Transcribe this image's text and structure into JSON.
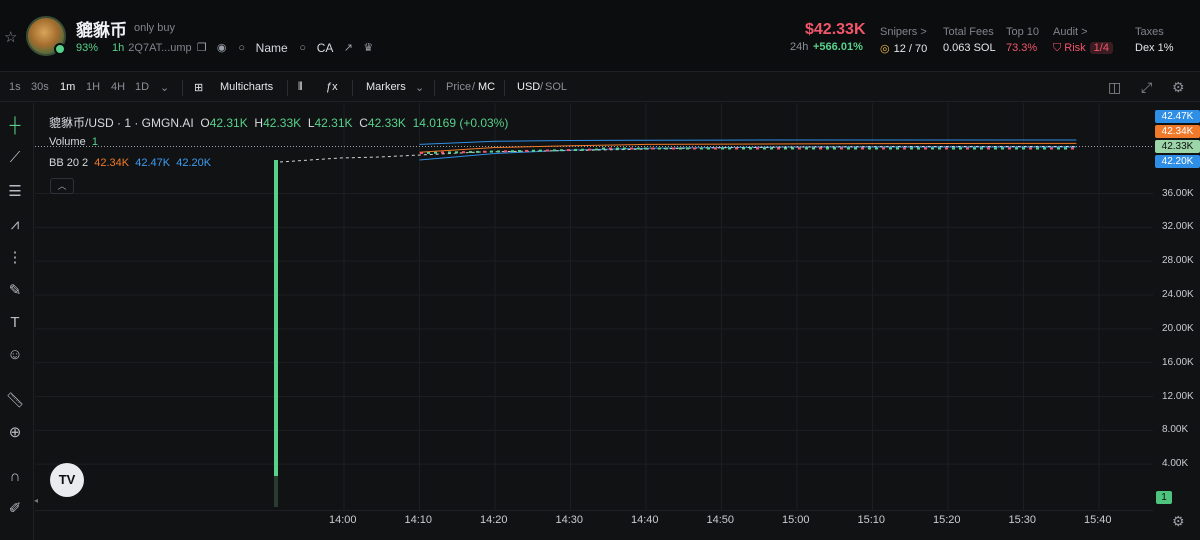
{
  "header": {
    "token_name": "貔貅币",
    "tag": "only buy",
    "holder_pct": "93%",
    "age": "1h",
    "address": "2Q7AT...ump",
    "links": [
      "Name",
      "CA"
    ],
    "price": "$42.33K",
    "change_label": "24h",
    "change_value": "+566.01%",
    "stats": [
      {
        "label": "Snipers >",
        "value": "12 / 70"
      },
      {
        "label": "Total Fees",
        "value": "0.063 SOL"
      },
      {
        "label": "Top 10",
        "value": "73.3%"
      },
      {
        "label": "Audit >",
        "value": "Risk",
        "badge": "1/4"
      },
      {
        "label": "Taxes",
        "value": "Dex 1%"
      }
    ]
  },
  "toolbar": {
    "intervals": [
      "1s",
      "30s",
      "1m",
      "1H",
      "4H",
      "1D"
    ],
    "active_interval": "1m",
    "multicharts": "Multicharts",
    "markers": "Markers",
    "price_mc": [
      "Price",
      "MC"
    ],
    "usd_sol": [
      "USD",
      "SOL"
    ]
  },
  "legend": {
    "symbol": "貔貅币/USD · 1 · GMGN.AI",
    "o_label": "O",
    "o": "42.31K",
    "h_label": "H",
    "h": "42.33K",
    "l_label": "L",
    "l": "42.31K",
    "c_label": "C",
    "c": "42.33K",
    "change": "14.0169 (+0.03%)",
    "volume_label": "Volume",
    "volume": "1",
    "bb_label": "BB 20 2",
    "bb_basis": "42.34K",
    "bb_upper": "42.47K",
    "bb_lower": "42.20K"
  },
  "tv_logo": "TV",
  "colors": {
    "up": "#58d18a",
    "down": "#f2566b",
    "bb_upper": "#2f8fe6",
    "bb_basis": "#f07a2a",
    "price_tag": "#9cd6a8"
  },
  "chart_data": {
    "type": "line",
    "title": "貔貅币/USD · 1 · GMGN.AI",
    "ylim": [
      0,
      42470
    ],
    "y_ticks": [
      "36.00K",
      "32.00K",
      "28.00K",
      "24.00K",
      "20.00K",
      "16.00K",
      "12.00K",
      "8.00K",
      "4.00K"
    ],
    "x_ticks": [
      "14:00",
      "14:10",
      "14:20",
      "14:30",
      "14:40",
      "14:50",
      "15:00",
      "15:10",
      "15:20",
      "15:30",
      "15:40"
    ],
    "price_tags": [
      {
        "value": "42.47K",
        "color": "#2f8fe6"
      },
      {
        "value": "42.34K",
        "color": "#f07a2a"
      },
      {
        "value": "42.33K",
        "color": "#9cd6a8"
      },
      {
        "value": "42.20K",
        "color": "#2f8fe6"
      }
    ],
    "volume_tag": "1",
    "series": [
      {
        "name": "BB basis",
        "x": [
          "14:10",
          "14:20",
          "14:30",
          "14:40",
          "14:50",
          "15:00",
          "15:10",
          "15:20",
          "15:30",
          "15:37"
        ],
        "values": [
          42000,
          42180,
          42250,
          42300,
          42310,
          42320,
          42330,
          42335,
          42340,
          42340
        ]
      },
      {
        "name": "BB upper",
        "x": [
          "14:10",
          "14:20",
          "14:30",
          "14:40",
          "14:50",
          "15:00",
          "15:10",
          "15:20",
          "15:30",
          "15:37"
        ],
        "values": [
          42300,
          42420,
          42450,
          42460,
          42465,
          42470,
          42470,
          42470,
          42470,
          42470
        ]
      },
      {
        "name": "BB lower",
        "x": [
          "14:10",
          "14:20",
          "14:30",
          "14:40",
          "14:50",
          "15:00",
          "15:10",
          "15:20",
          "15:30",
          "15:37"
        ],
        "values": [
          41700,
          41950,
          42080,
          42150,
          42180,
          42200,
          42200,
          42200,
          42200,
          42200
        ]
      }
    ]
  }
}
